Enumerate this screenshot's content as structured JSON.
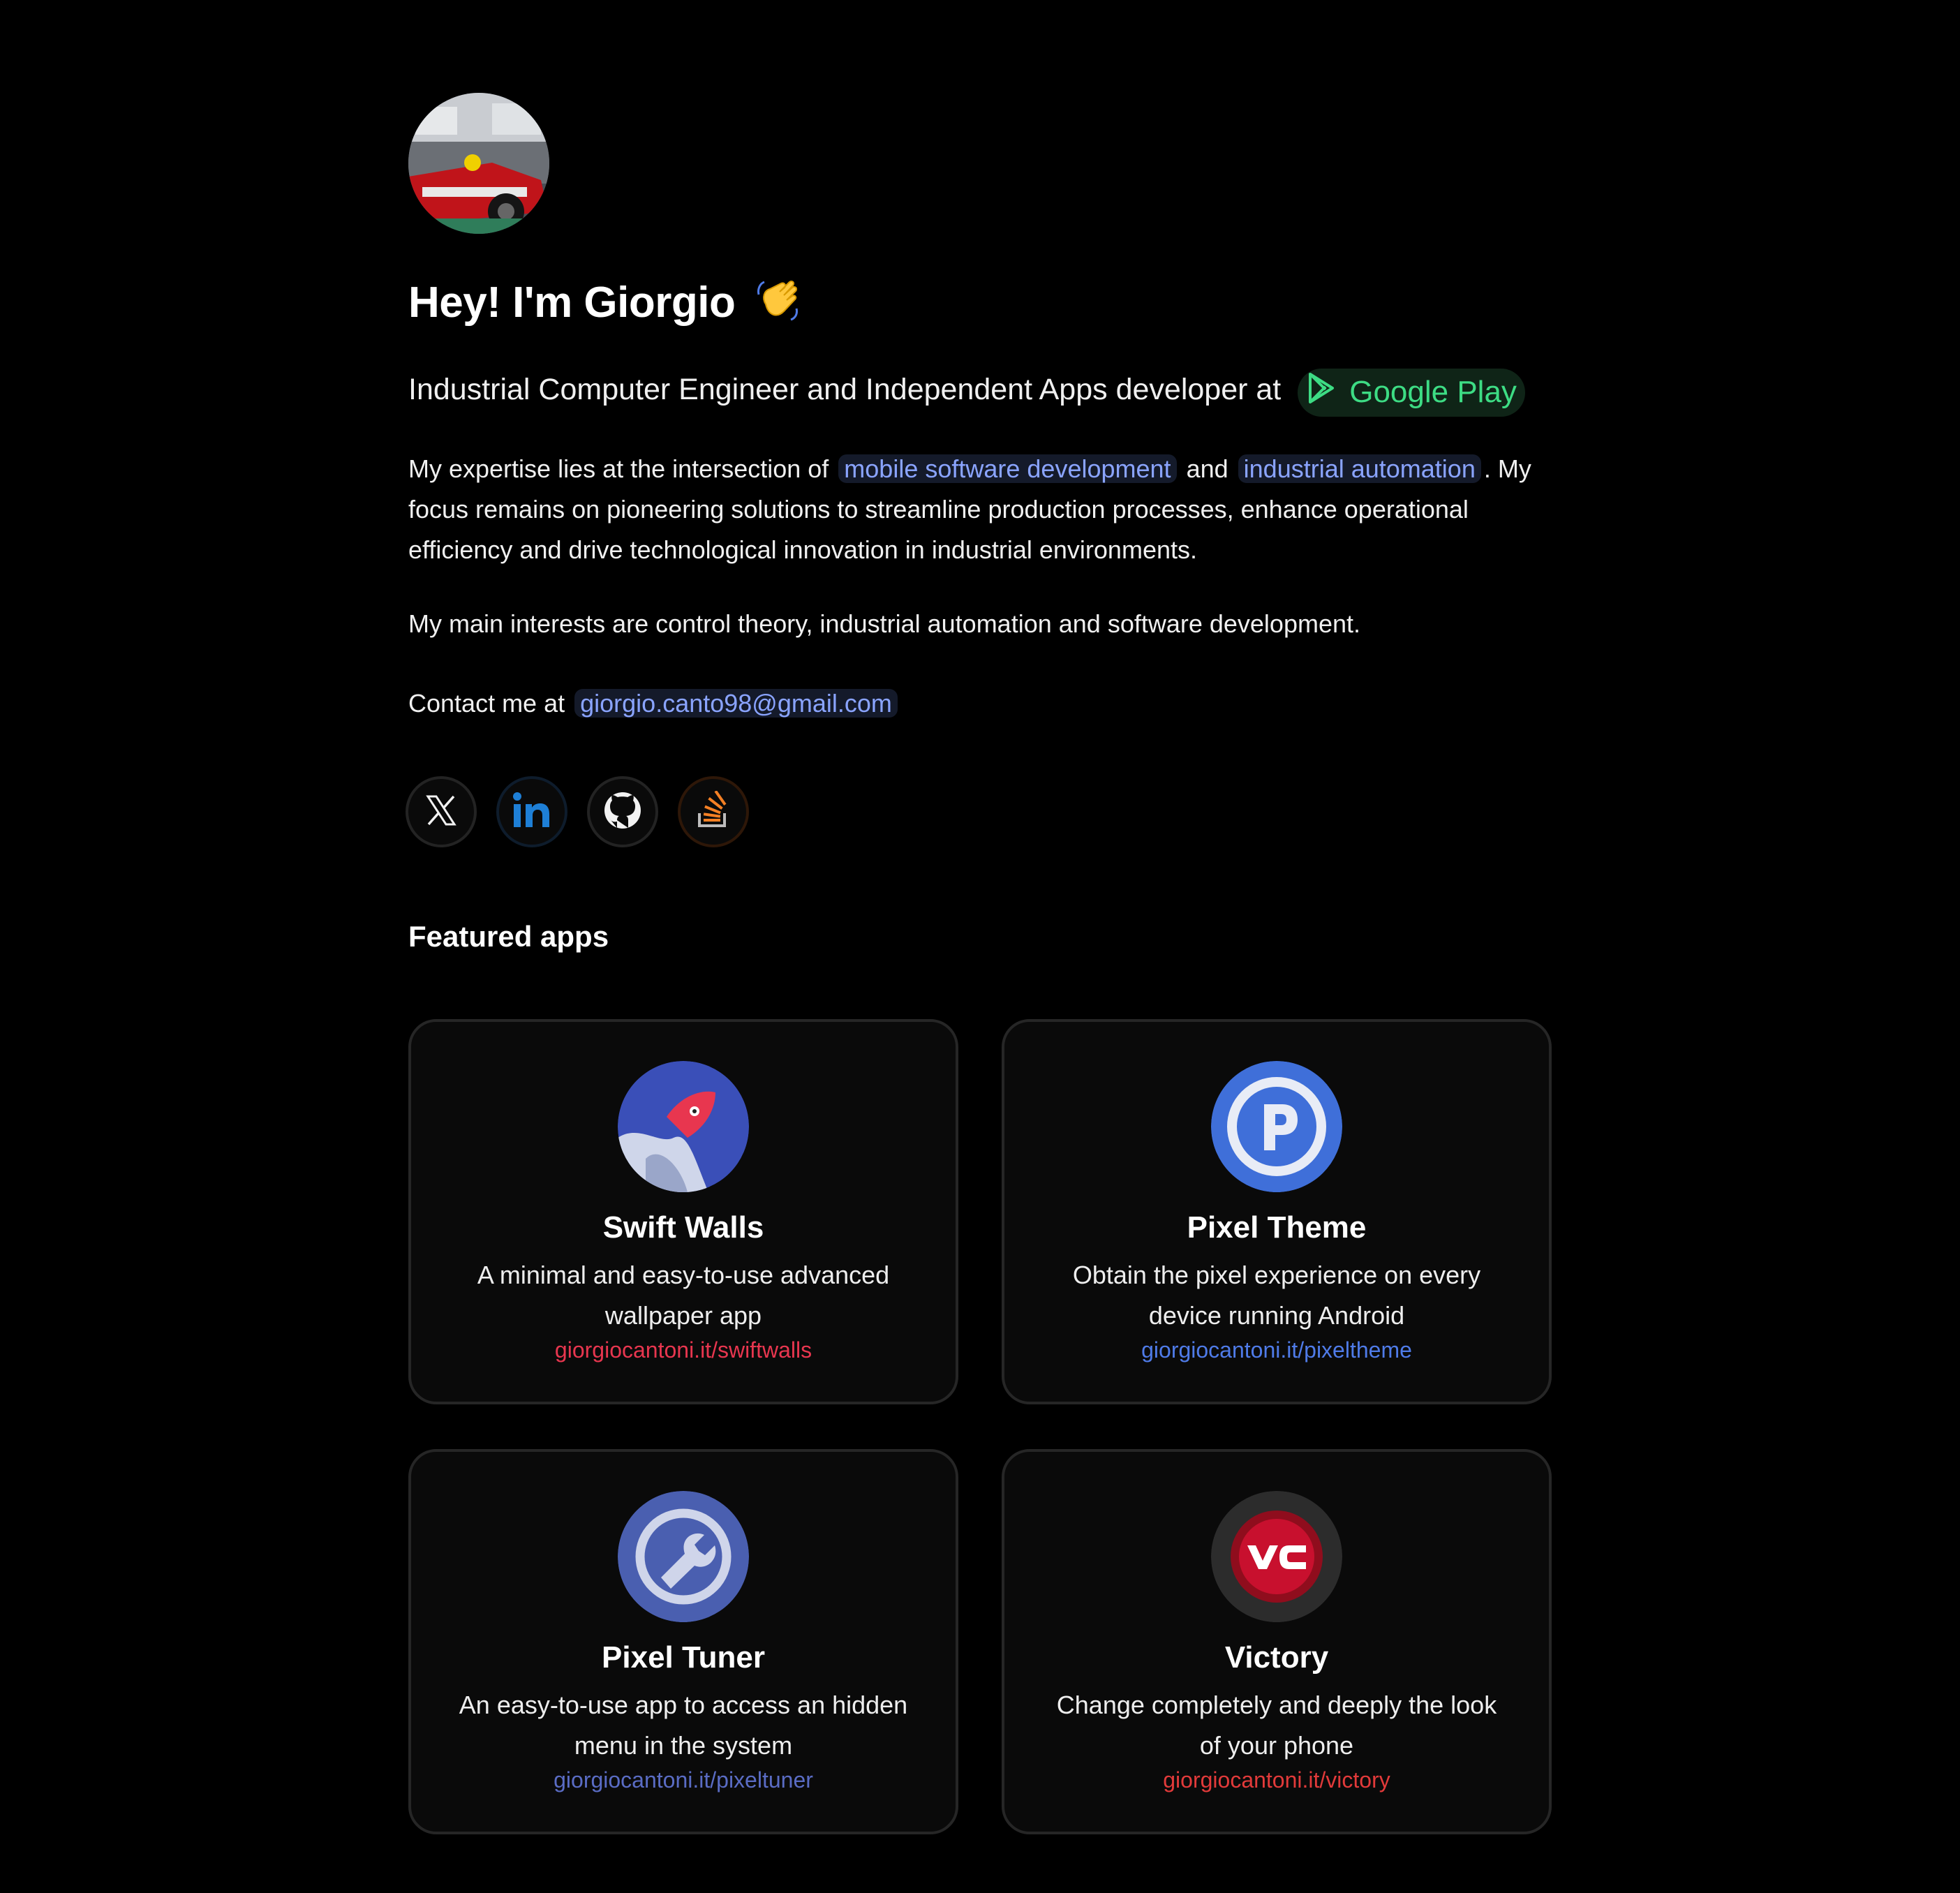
{
  "profile": {
    "avatar_alt": "Profile photo",
    "heading": "Hey! I'm Giorgio",
    "subtitle": "Industrial Computer Engineer and Independent Apps developer at",
    "store_label": "Google Play"
  },
  "about": {
    "p1_a": "My expertise lies at the intersection of",
    "p1_hl1": "mobile software development",
    "p1_b": "and",
    "p1_hl2": "industrial automation",
    "p1_c": ". My focus remains on pioneering solutions to streamline production processes, enhance operational efficiency and drive technological innovation in industrial environments.",
    "p2": "My main interests are control theory, industrial automation and software development.",
    "contact_prefix": "Contact me at",
    "email": "giorgio.canto98@gmail.com"
  },
  "socials": [
    {
      "name": "X",
      "icon": "x-icon"
    },
    {
      "name": "LinkedIn",
      "icon": "linkedin-icon"
    },
    {
      "name": "GitHub",
      "icon": "github-icon"
    },
    {
      "name": "Stack Overflow",
      "icon": "stackoverflow-icon"
    }
  ],
  "featured": {
    "title": "Featured apps",
    "apps": [
      {
        "name": "Swift Walls",
        "desc": "A minimal and easy-to-use advanced wallpaper app",
        "link": "giorgiocantoni.it/swiftwalls",
        "color": "#e8364f"
      },
      {
        "name": "Pixel Theme",
        "desc": "Obtain the pixel experience on every device running Android",
        "link": "giorgiocantoni.it/pixeltheme",
        "color": "#4f7be8"
      },
      {
        "name": "Pixel Tuner",
        "desc": "An easy-to-use app to access an hidden menu in the system",
        "link": "giorgiocantoni.it/pixeltuner",
        "color": "#5a6cc4"
      },
      {
        "name": "Victory",
        "desc": "Change completely and deeply the look of your phone",
        "link": "giorgiocantoni.it/victory",
        "color": "#e23a3a"
      }
    ]
  },
  "colors": {
    "background": "#000000",
    "accent_blue": "#8aa4ff",
    "google_play_green": "#3ddc84"
  }
}
